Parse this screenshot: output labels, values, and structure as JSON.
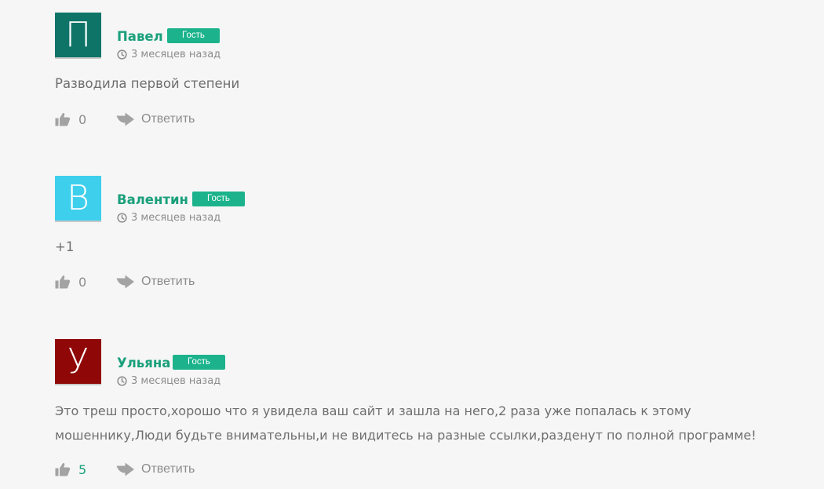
{
  "colors": {
    "author": "#19a07b",
    "badge": "#1cb38c",
    "likes_positive": "#19a07b",
    "likes_zero": "#8c8c8c",
    "icon": "#a3a3a3"
  },
  "comments": [
    {
      "author": "Павел",
      "avatar_letter": "П",
      "avatar_color": "#0e7468",
      "badge": "Гость",
      "time": "3 месяцев назад",
      "text": "Разводила первой степени",
      "likes": "0",
      "reply_label": "Ответить",
      "icons": {
        "clock": "clock-icon",
        "like": "thumbs-up-icon",
        "reply": "reply-arrow-icon"
      }
    },
    {
      "author": "Валентин",
      "avatar_letter": "В",
      "avatar_color": "#3ecfec",
      "badge": "Гость",
      "time": "3 месяцев назад",
      "text": "+1",
      "likes": "0",
      "reply_label": "Ответить",
      "icons": {
        "clock": "clock-icon",
        "like": "thumbs-up-icon",
        "reply": "reply-arrow-icon"
      }
    },
    {
      "author": "Ульяна",
      "avatar_letter": "У",
      "avatar_color": "#8f0707",
      "badge": "Гость",
      "time": "3 месяцев назад",
      "text": "Это треш просто,хорошо что я увидела ваш сайт и зашла на него,2 раза уже попалась к этому мошеннику,Люди будьте внимательны,и не видитесь на разные ссылки,разденут по полной программе!",
      "likes": "5",
      "reply_label": "Ответить",
      "icons": {
        "clock": "clock-icon",
        "like": "thumbs-up-icon",
        "reply": "reply-arrow-icon"
      }
    }
  ]
}
